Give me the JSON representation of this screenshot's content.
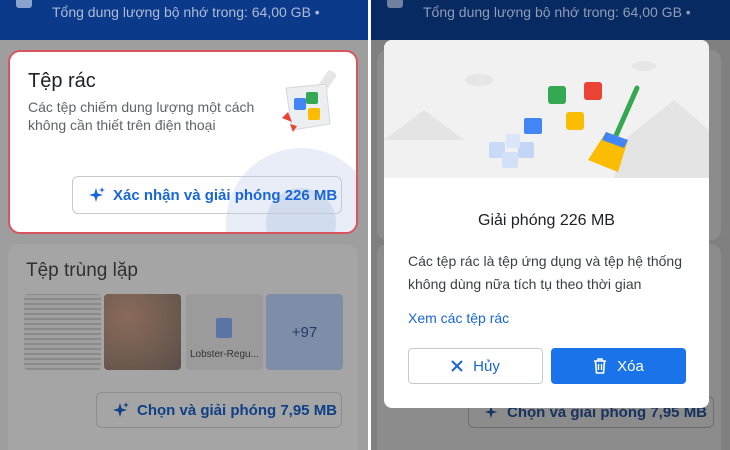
{
  "left_screen": {
    "storage_text": "Tổng dung lượng bộ nhớ trong: 64,00 GB •",
    "junk_card": {
      "title": "Tệp rác",
      "description": "Các tệp chiếm dung lượng một cách không cần thiết trên điện thoại",
      "button_label": "Xác nhận và giải phóng 226 MB"
    },
    "duplicates_card": {
      "title": "Tệp trùng lặp",
      "thumb_caption": "Lobster-Regu...",
      "more_count": "+97",
      "button_label": "Chọn và giải phóng 7,95 MB"
    }
  },
  "right_screen": {
    "storage_text": "Tổng dung lượng bộ nhớ trong: 64,00 GB •",
    "dialog": {
      "title": "Giải phóng 226 MB",
      "body": "Các tệp rác là tệp ứng dụng và tệp hệ thống không dùng nữa tích tụ theo thời gian",
      "link": "Xem các tệp rác",
      "cancel_label": "Hủy",
      "delete_label": "Xóa"
    },
    "underlying_button_label": "Chọn và giải phóng 7,95 MB"
  },
  "colors": {
    "accent": "#1a73e8",
    "topbar": "#0b3a8a",
    "highlight_border": "#d9545f"
  },
  "icons": [
    "sparkle-icon",
    "close-icon",
    "trash-icon",
    "document-icon",
    "broom-icon"
  ]
}
